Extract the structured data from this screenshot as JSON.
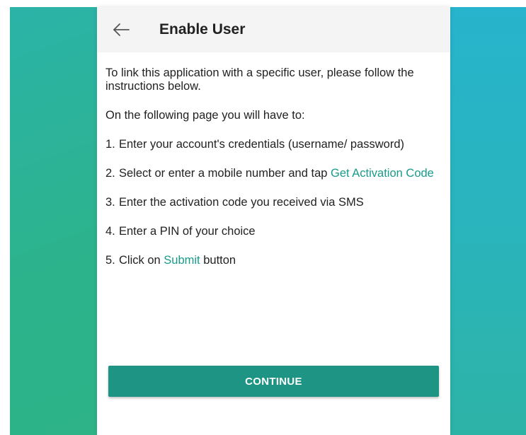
{
  "header": {
    "title": "Enable User",
    "back_icon": "arrow-left-icon"
  },
  "instructions": {
    "intro": "To link this application with a specific user, please follow the instructions below.",
    "lead": "On the following page you will have to:",
    "steps": [
      {
        "number": "1.",
        "text": "Enter your account's credentials (username/ password)"
      },
      {
        "number": "2.",
        "text_before": "Select or enter a mobile number and tap ",
        "link": "Get Activation Code"
      },
      {
        "number": "3.",
        "text": "Enter the activation code you received via SMS"
      },
      {
        "number": "4.",
        "text": "Enter a PIN of your choice"
      },
      {
        "number": "5.",
        "text_before": "Click on ",
        "link": "Submit",
        "text_after": " button"
      }
    ]
  },
  "actions": {
    "continue_label": "CONTINUE"
  },
  "colors": {
    "accent": "#1e9484",
    "link": "#1a9a8a",
    "appbar": "#f4f4f4",
    "background_gradient_start": "#2bb3a8",
    "background_gradient_end": "#2fb383"
  }
}
